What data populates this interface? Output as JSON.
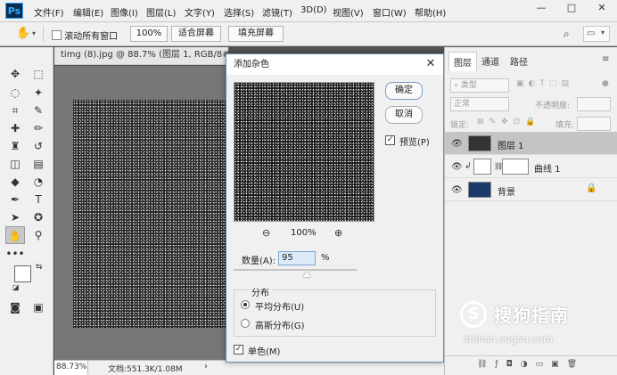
{
  "menubar": {
    "logo": "Ps",
    "items": [
      "文件(F)",
      "编辑(E)",
      "图像(I)",
      "图层(L)",
      "文字(Y)",
      "选择(S)",
      "滤镜(T)",
      "3D(D)",
      "视图(V)",
      "窗口(W)",
      "帮助(H)"
    ],
    "minimize": "—",
    "restore": "□",
    "close": "✕"
  },
  "options": {
    "scroll_all_label": "滚动所有窗口",
    "zoom_btn": "100%",
    "fit_screen": "适合屏幕",
    "fill_screen": "填充屏幕"
  },
  "document": {
    "tab_title": "timg (8).jpg @ 88.7% (图层 1, RGB/8#) *",
    "tab_close": "✕",
    "zoom": "88.73%",
    "doc_info": "文档:551.3K/1.08M"
  },
  "dialog": {
    "title": "添加杂色",
    "close": "✕",
    "ok": "确定",
    "cancel": "取消",
    "preview_label": "预览(P)",
    "preview_checked": true,
    "zoom_level": "100%",
    "amount_label": "数量(A):",
    "amount_value": "95",
    "amount_unit": "%",
    "amount_fraction": 0.95,
    "distribution_label": "分布",
    "uniform_label": "平均分布(U)",
    "gaussian_label": "高斯分布(G)",
    "selected_distribution": "uniform",
    "mono_label": "单色(M)",
    "mono_checked": true
  },
  "layers_panel": {
    "tabs": [
      "图层",
      "通道",
      "路径"
    ],
    "active_tab": "图层",
    "filter_kind": "类型",
    "blend_mode": "正常",
    "opacity_label": "不透明度:",
    "lock_label": "锁定:",
    "fill_label": "填充:",
    "layers": [
      {
        "name": "图层 1",
        "selected": true
      },
      {
        "name": "曲线 1",
        "selected": false
      },
      {
        "name": "背景",
        "selected": false
      }
    ]
  },
  "watermark": {
    "brand": "搜狗指南",
    "url": "zhinan.sogou.com"
  }
}
